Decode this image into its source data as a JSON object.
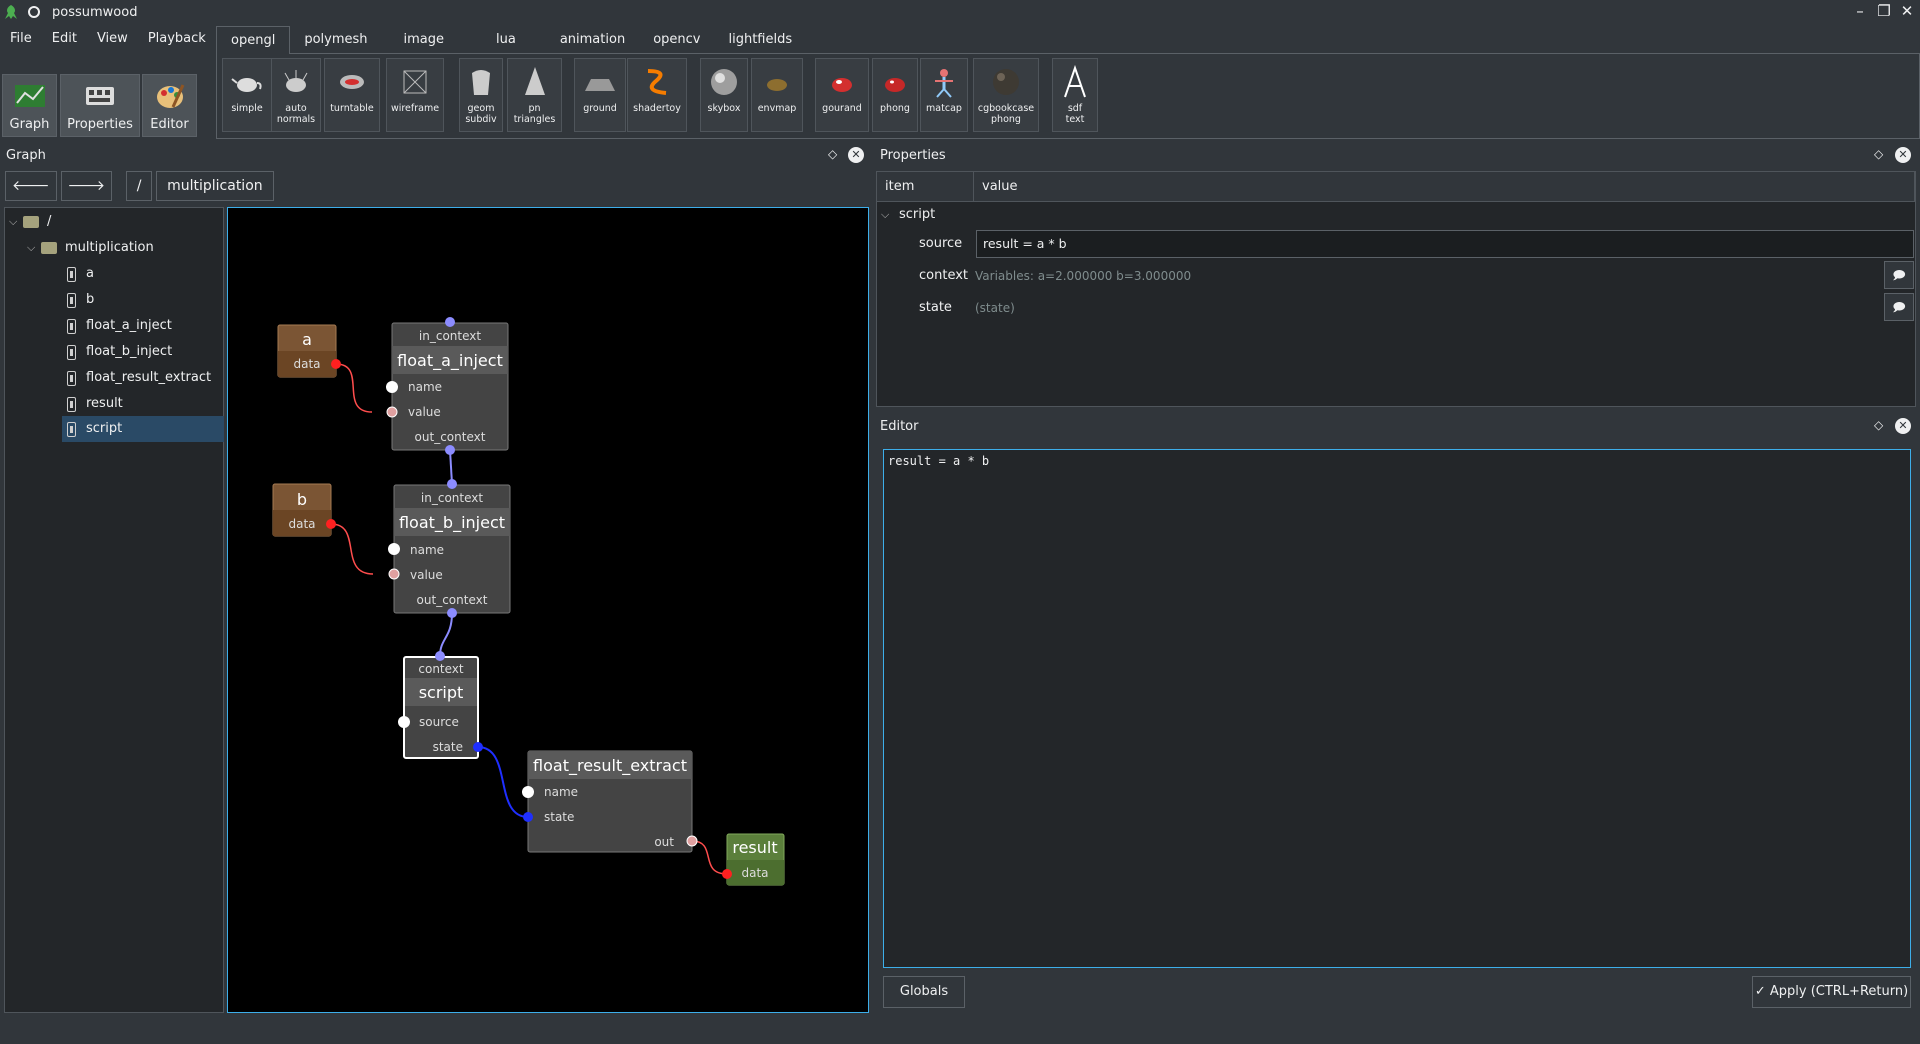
{
  "window": {
    "title": "possumwood",
    "controls": [
      "–",
      "❐",
      "✕"
    ]
  },
  "menu": [
    "File",
    "Edit",
    "View",
    "Playback"
  ],
  "view_buttons": [
    {
      "label": "Graph"
    },
    {
      "label": "Properties"
    },
    {
      "label": "Editor"
    }
  ],
  "tabs": [
    "opengl",
    "polymesh",
    "image",
    "lua",
    "animation",
    "opencv",
    "lightfields"
  ],
  "active_tab": "opengl",
  "tools": [
    {
      "label": "simple"
    },
    {
      "label": "auto\nnormals"
    },
    {
      "label": "turntable"
    },
    {
      "label": "wireframe"
    },
    {
      "label": "geom\nsubdiv"
    },
    {
      "label": "pn\ntriangles"
    },
    {
      "label": "ground"
    },
    {
      "label": "shadertoy"
    },
    {
      "label": "skybox"
    },
    {
      "label": "envmap"
    },
    {
      "label": "gourand"
    },
    {
      "label": "phong"
    },
    {
      "label": "matcap"
    },
    {
      "label": "cgbookcase\nphong"
    },
    {
      "label": "sdf\ntext"
    }
  ],
  "graph_panel": {
    "title": "Graph",
    "nav": {
      "back": "🡐",
      "forward": "🡒",
      "root": "/",
      "path": "multiplication"
    },
    "tree": [
      {
        "label": "/",
        "type": "folder"
      },
      {
        "label": "multiplication",
        "type": "folder"
      },
      {
        "label": "a",
        "type": "node"
      },
      {
        "label": "b",
        "type": "node"
      },
      {
        "label": "float_a_inject",
        "type": "node"
      },
      {
        "label": "float_b_inject",
        "type": "node"
      },
      {
        "label": "float_result_extract",
        "type": "node"
      },
      {
        "label": "result",
        "type": "node"
      },
      {
        "label": "script",
        "type": "node",
        "selected": true
      }
    ],
    "nodes": {
      "a": {
        "title": "a",
        "port": "data"
      },
      "b": {
        "title": "b",
        "port": "data"
      },
      "float_a_inject": {
        "in": "in_context",
        "title": "float_a_inject",
        "ports": [
          "name",
          "value"
        ],
        "out": "out_context"
      },
      "float_b_inject": {
        "in": "in_context",
        "title": "float_b_inject",
        "ports": [
          "name",
          "value"
        ],
        "out": "out_context"
      },
      "script": {
        "in": "context",
        "title": "script",
        "ports": [
          "source",
          "state"
        ]
      },
      "float_result_extract": {
        "title": "float_result_extract",
        "ports": [
          "name",
          "state",
          "out"
        ]
      },
      "result": {
        "title": "result",
        "port": "data"
      }
    }
  },
  "properties_panel": {
    "title": "Properties",
    "columns": [
      "item",
      "value"
    ],
    "group": "script",
    "rows": [
      {
        "item": "source",
        "value": "result = a * b"
      },
      {
        "item": "context",
        "value": "Variables: a=2.000000 b=3.000000"
      },
      {
        "item": "state",
        "value": "(state)"
      }
    ]
  },
  "editor_panel": {
    "title": "Editor",
    "code": "result = a * b",
    "globals_label": "Globals",
    "apply_label": "Apply (CTRL+Return)"
  },
  "colors": {
    "bg": "#31363b",
    "panel": "#232629",
    "accent": "#3daee9",
    "node_brown": "#7b5534",
    "node_green": "#5b7f3b",
    "node_gray": "#505050"
  }
}
